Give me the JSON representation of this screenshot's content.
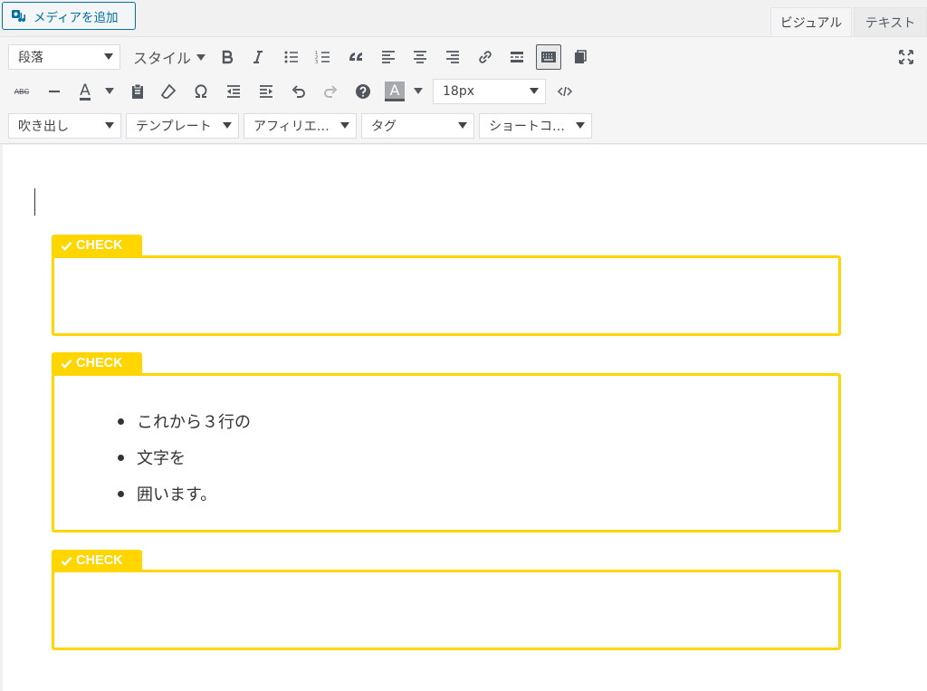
{
  "topbar": {
    "media_button": "メディアを追加",
    "tabs": [
      {
        "label": "ビジュアル",
        "active": true
      },
      {
        "label": "テキスト",
        "active": false
      }
    ]
  },
  "toolbar": {
    "format_select": "段落",
    "style_select": "スタイル",
    "font_size_select": "18px",
    "row3": {
      "balloon": "吹き出し",
      "template": "テンプレート",
      "affiliate": "アフィリエ…",
      "tag": "タグ",
      "shortcode": "ショートコ…"
    },
    "text_color_letter": "A",
    "bg_color_letter": "A",
    "strike_label": "ABC"
  },
  "editor": {
    "boxes": [
      {
        "label": "CHECK",
        "items": []
      },
      {
        "label": "CHECK",
        "items": [
          "これから３行の",
          "文字を",
          "囲います。"
        ]
      },
      {
        "label": "CHECK",
        "items": []
      }
    ]
  },
  "colors": {
    "accent_yellow": "#ffd600",
    "media_blue": "#0071a1"
  }
}
